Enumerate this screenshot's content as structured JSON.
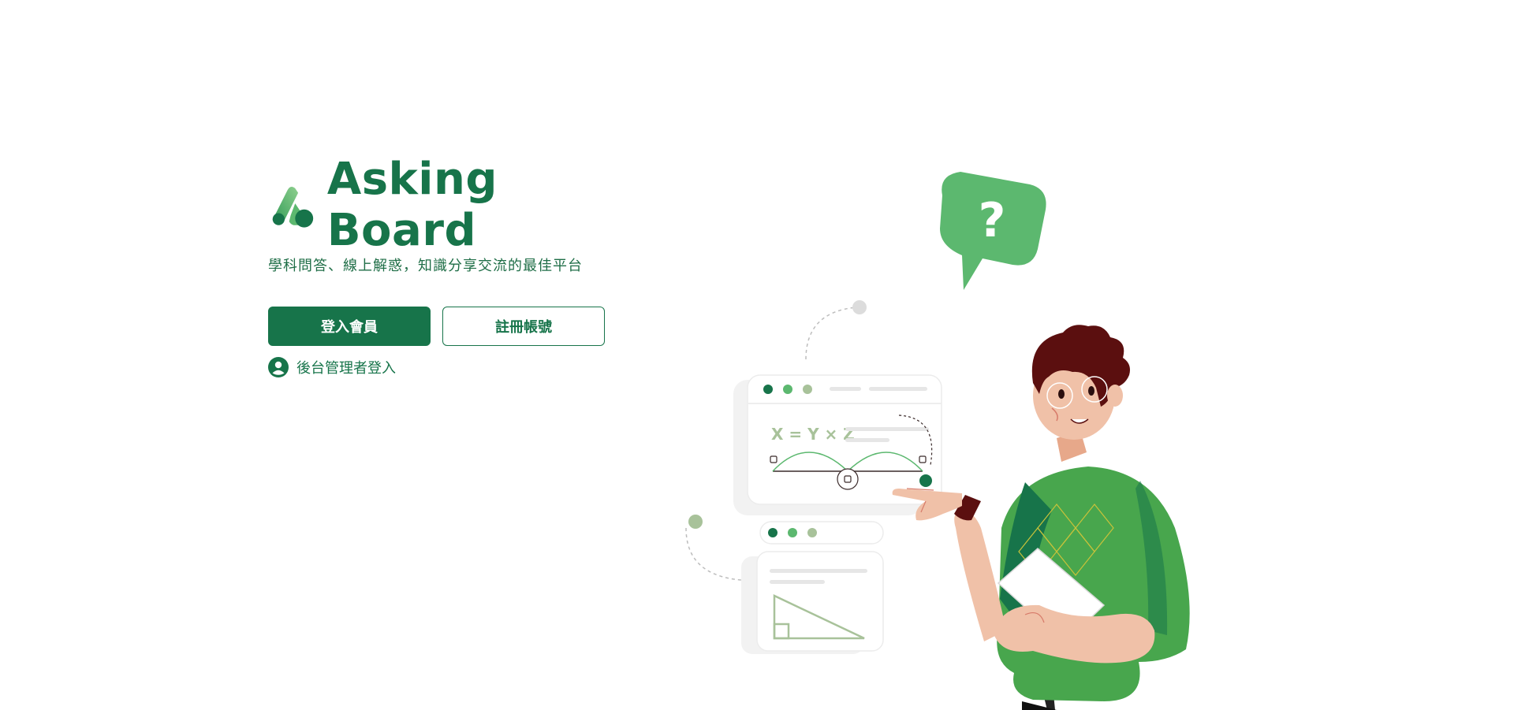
{
  "brand": {
    "name": "Asking Board"
  },
  "tagline": "學科問答、線上解惑，知識分享交流的最佳平台",
  "actions": {
    "login_label": "登入會員",
    "register_label": "註冊帳號"
  },
  "admin_link": {
    "label": "後台管理者登入"
  },
  "illustration": {
    "formula_text": "X = Y × Z",
    "speech_bubble_glyph": "?"
  },
  "colors": {
    "primary": "#17744a",
    "accent": "#5cb86f",
    "light": "#a8c29a",
    "skin": "#f0c1a8"
  }
}
